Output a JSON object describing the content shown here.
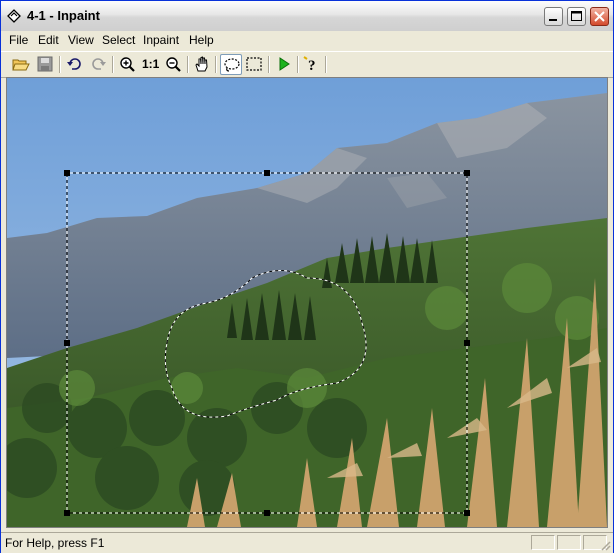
{
  "window": {
    "title": "4-1 - Inpaint"
  },
  "menu": [
    "File",
    "Edit",
    "View",
    "Select",
    "Inpaint",
    "Help"
  ],
  "toolbar": {
    "tools": [
      {
        "name": "open-icon",
        "tooltip": "Open"
      },
      {
        "name": "save-icon",
        "tooltip": "Save"
      },
      {
        "name": "undo-icon",
        "tooltip": "Undo"
      },
      {
        "name": "redo-icon",
        "tooltip": "Redo"
      },
      {
        "name": "zoom-in-icon",
        "tooltip": "Zoom In"
      },
      {
        "name": "actual-size-icon",
        "label": "1:1"
      },
      {
        "name": "zoom-out-icon",
        "tooltip": "Zoom Out"
      },
      {
        "name": "hand-icon",
        "tooltip": "Pan"
      },
      {
        "name": "lasso-icon",
        "tooltip": "Lasso Select",
        "pressed": true
      },
      {
        "name": "rect-select-icon",
        "tooltip": "Rectangle Select"
      },
      {
        "name": "play-icon",
        "tooltip": "Inpaint"
      },
      {
        "name": "help-icon",
        "tooltip": "Help"
      }
    ]
  },
  "canvas": {
    "image": "mountain landscape with forest and dry corn stalks"
  },
  "status": {
    "text": "For Help, press F1"
  }
}
